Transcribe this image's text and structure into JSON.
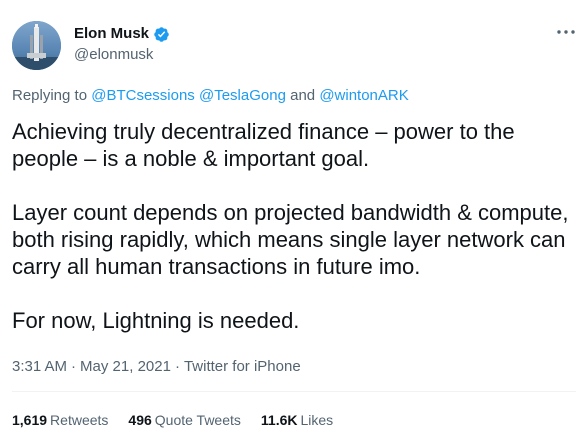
{
  "author": {
    "display_name": "Elon Musk",
    "handle": "@elonmusk",
    "verified": true,
    "avatar_icon": "avatar-rocket-photo",
    "verified_color": "#1d9bf0"
  },
  "reply": {
    "prefix": "Replying to ",
    "mention1": "@BTCsessions",
    "space1": " ",
    "mention2": "@TeslaGong",
    "and_word": " and ",
    "mention3": "@wintonARK"
  },
  "body": {
    "paragraphs": [
      "Achieving truly decentralized finance – power to the people – is a noble & important goal.",
      "Layer count depends on projected bandwidth & compute, both rising rapidly, which means single layer network can carry all human transactions in future imo.",
      "For now, Lightning is needed."
    ]
  },
  "meta": {
    "time": "3:31 AM",
    "separator": "·",
    "date": "May 21, 2021",
    "source": "Twitter for iPhone"
  },
  "stats": {
    "retweets_count": "1,619",
    "retweets_label": "Retweets",
    "quotes_count": "496",
    "quotes_label": "Quote Tweets",
    "likes_count": "11.6K",
    "likes_label": "Likes"
  },
  "colors": {
    "link": "#1d9bf0",
    "secondary_text": "#536471",
    "primary_text": "#0f1419"
  }
}
